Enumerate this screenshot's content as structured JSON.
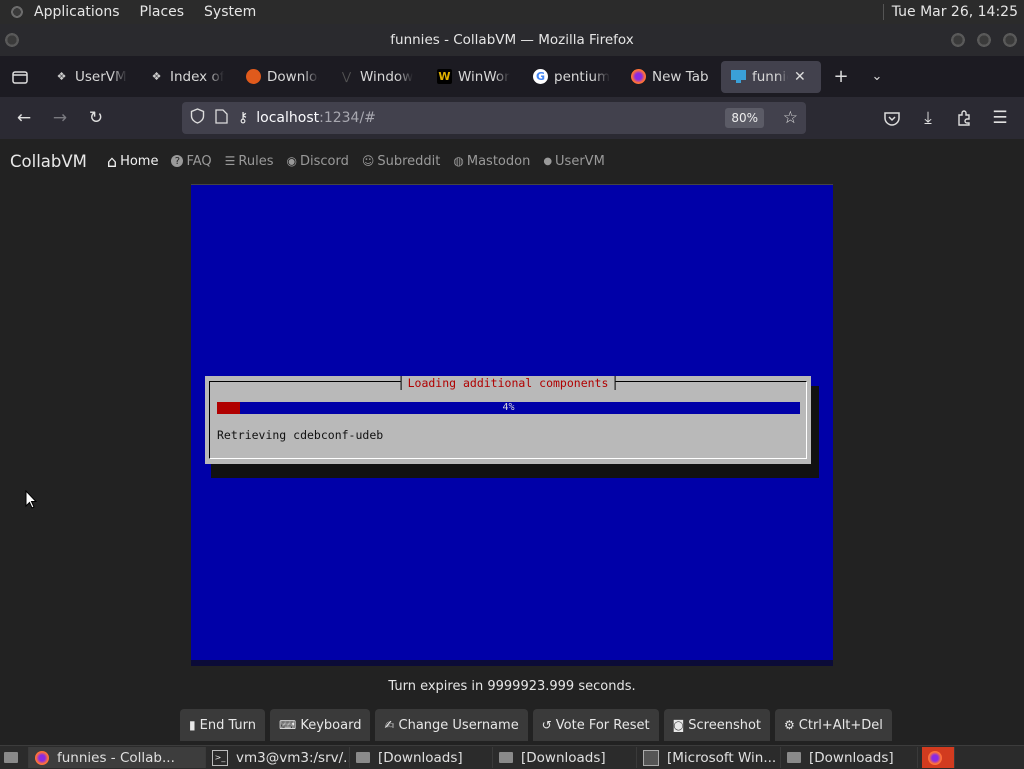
{
  "top_panel": {
    "menus": [
      "Applications",
      "Places",
      "System"
    ],
    "clock": "Tue Mar 26, 14:25"
  },
  "window": {
    "title": "funnies - CollabVM — Mozilla Firefox"
  },
  "tabs": [
    {
      "label": "UserVM",
      "icon": "uservm-icon"
    },
    {
      "label": "Index of",
      "icon": "index-icon"
    },
    {
      "label": "Downloa",
      "icon": "download-site-icon"
    },
    {
      "label": "Window",
      "icon": "windows-site-icon"
    },
    {
      "label": "WinWor",
      "icon": "winworld-icon"
    },
    {
      "label": "pentium",
      "icon": "google-icon"
    },
    {
      "label": "New Tab",
      "icon": "firefox-icon"
    },
    {
      "label": "funnie",
      "icon": "monitor-icon",
      "active": true
    }
  ],
  "navbar": {
    "url_host": "localhost",
    "url_rest": ":1234/#",
    "zoom": "80%"
  },
  "site": {
    "brand": "CollabVM",
    "links": [
      {
        "label": "Home",
        "icon": "home-icon",
        "glyph": "⌂"
      },
      {
        "label": "FAQ",
        "icon": "question-icon",
        "glyph": "?"
      },
      {
        "label": "Rules",
        "icon": "rules-icon",
        "glyph": "☰"
      },
      {
        "label": "Discord",
        "icon": "discord-icon",
        "glyph": "◉"
      },
      {
        "label": "Subreddit",
        "icon": "reddit-icon",
        "glyph": "☺"
      },
      {
        "label": "Mastodon",
        "icon": "mastodon-icon",
        "glyph": "◍"
      },
      {
        "label": "UserVM",
        "icon": "user-icon",
        "glyph": "●"
      }
    ]
  },
  "installer": {
    "title": "Loading additional components",
    "progress": 4,
    "progress_label": "4%",
    "message": "Retrieving cdebconf-udeb"
  },
  "turn_text": "Turn expires in 9999923.999 seconds.",
  "vm_buttons": [
    {
      "label": "End Turn",
      "icon": "end-turn-icon",
      "glyph": "▮"
    },
    {
      "label": "Keyboard",
      "icon": "keyboard-icon",
      "glyph": "⌨"
    },
    {
      "label": "Change Username",
      "icon": "signature-icon",
      "glyph": "✍"
    },
    {
      "label": "Vote For Reset",
      "icon": "undo-icon",
      "glyph": "↺"
    },
    {
      "label": "Screenshot",
      "icon": "camera-icon",
      "glyph": "◙"
    },
    {
      "label": "Ctrl+Alt+Del",
      "icon": "gear-icon",
      "glyph": "⚙"
    }
  ],
  "taskbar": [
    {
      "label": "funnies - Collab...",
      "icon": "firefox-icon",
      "active": true
    },
    {
      "label": "vm3@vm3:/srv/...",
      "icon": "terminal-icon"
    },
    {
      "label": "[Downloads]",
      "icon": "folder-icon"
    },
    {
      "label": "[Downloads]",
      "icon": "folder-icon"
    },
    {
      "label": "[Microsoft Win...",
      "icon": "window-icon"
    },
    {
      "label": "[Downloads]",
      "icon": "folder-icon"
    }
  ]
}
